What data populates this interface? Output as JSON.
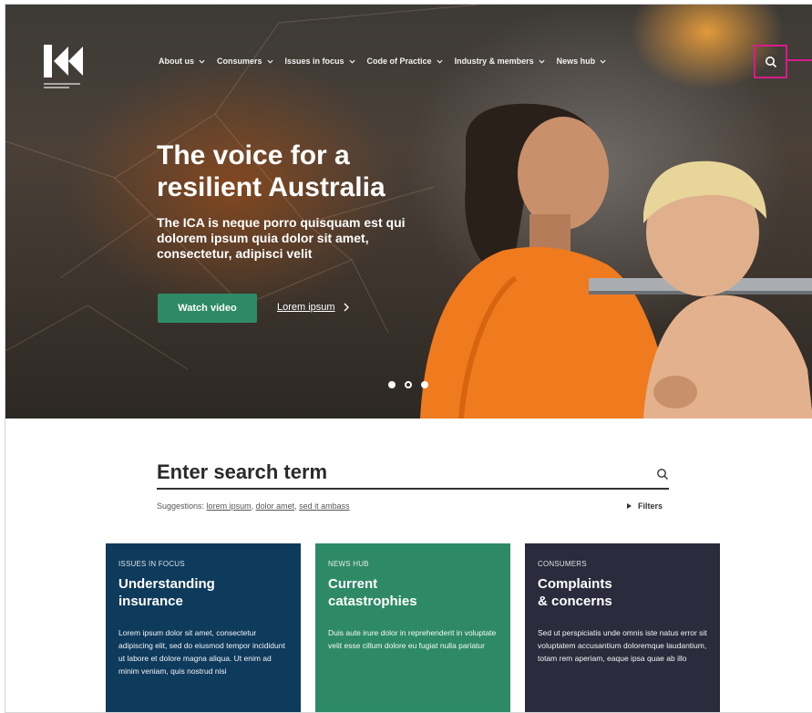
{
  "nav": {
    "items": [
      {
        "label": "About us"
      },
      {
        "label": "Consumers"
      },
      {
        "label": "Issues in focus"
      },
      {
        "label": "Code of Practice"
      },
      {
        "label": "Industry & members"
      },
      {
        "label": "News hub"
      }
    ]
  },
  "hero": {
    "title": "The voice for a resilient Australia",
    "text": "The ICA is neque porro quisquam est qui dolorem ipsum quia dolor sit amet, consectetur, adipisci velit",
    "primary_button": "Watch video",
    "secondary_link": "Lorem ipsum",
    "slides": 3,
    "active_slide": 2
  },
  "search": {
    "placeholder": "Enter search term",
    "suggestions_label": "Suggestions:",
    "suggestions": [
      "lorem ipsum",
      "dolor amet",
      "sed it ambass"
    ],
    "filters_label": "Filters"
  },
  "cards": [
    {
      "eyebrow": "ISSUES IN FOCUS",
      "title": "Understanding\ninsurance",
      "body": "Lorem ipsum dolor sit amet, consectetur adipiscing elit, sed do eiusmod tempor incididunt ut labore et dolore magna aliqua. Ut enim ad minim veniam, quis nostrud nisi",
      "color": "#0e3a5c"
    },
    {
      "eyebrow": "NEWS HUB",
      "title": "Current\ncatastrophies",
      "body": "Duis aute irure dolor in reprehenderit in voluptate velit esse cillum dolore eu fugiat nulla pariatur",
      "color": "#2e8a66"
    },
    {
      "eyebrow": "CONSUMERS",
      "title": "Complaints\n& concerns",
      "body": "Sed ut perspiciatis unde omnis iste natus error sit voluptatem accusantium doloremque laudantium, totam rem aperiam, eaque ipsa quae ab illo",
      "color": "#2b2b3d"
    }
  ],
  "colors": {
    "accent_green": "#2e8a66",
    "navy": "#0e3a5c",
    "charcoal": "#2b2b3d",
    "annotation": "#d81b8b"
  }
}
